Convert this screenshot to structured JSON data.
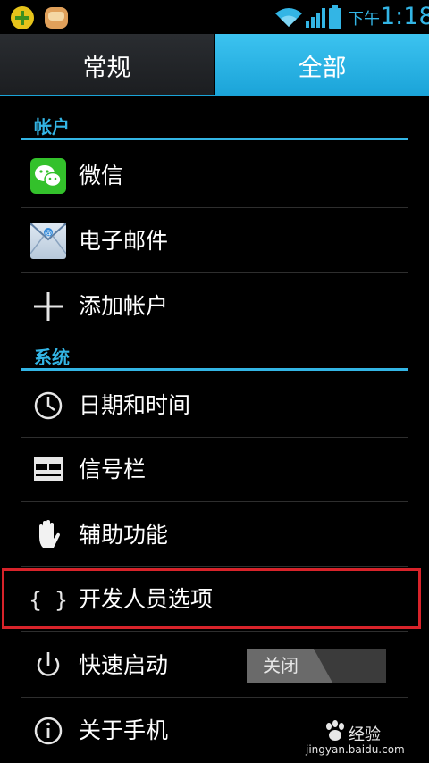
{
  "status_bar": {
    "ampm": "下午",
    "time": "1:18",
    "icons": [
      "notification-app-icon",
      "notification-app-icon-2",
      "wifi-icon",
      "signal-icon",
      "battery-icon"
    ]
  },
  "tabs": [
    {
      "label": "常规",
      "selected": false
    },
    {
      "label": "全部",
      "selected": true
    }
  ],
  "sections": {
    "accounts": {
      "header": "帐户",
      "items": [
        {
          "label": "微信",
          "icon": "wechat-icon"
        },
        {
          "label": "电子邮件",
          "icon": "email-icon"
        },
        {
          "label": "添加帐户",
          "icon": "plus-icon"
        }
      ]
    },
    "system": {
      "header": "系统",
      "items": [
        {
          "label": "日期和时间",
          "icon": "clock-icon"
        },
        {
          "label": "信号栏",
          "icon": "signal-bar-icon"
        },
        {
          "label": "辅助功能",
          "icon": "hand-icon"
        },
        {
          "label": "开发人员选项",
          "icon": "braces-icon",
          "highlighted": true
        },
        {
          "label": "快速启动",
          "icon": "power-icon",
          "toggle": "关闭"
        },
        {
          "label": "关于手机",
          "icon": "info-icon"
        }
      ]
    }
  },
  "colors": {
    "accent": "#33b5e5",
    "tab_selected": "#1aa3d8",
    "highlight_border": "#d8232a",
    "background": "#000000"
  },
  "watermark": {
    "title": "经验",
    "url": "jingyan.baidu.com"
  }
}
